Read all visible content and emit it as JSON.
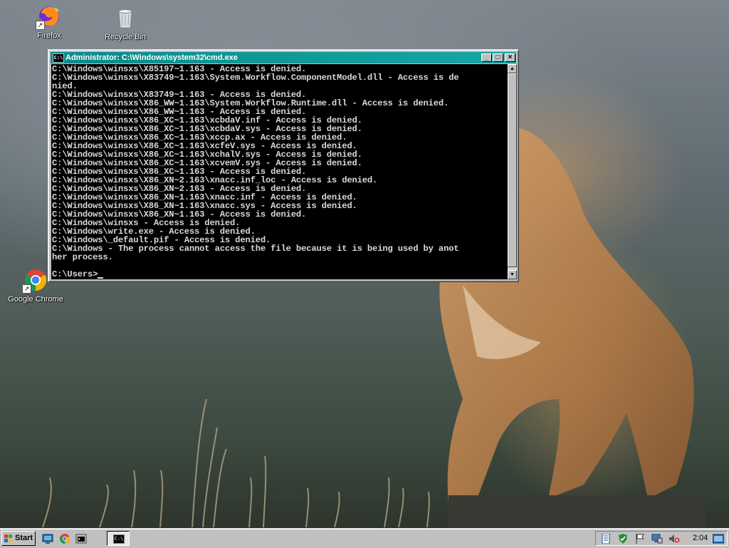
{
  "desktop": {
    "icons": [
      {
        "label": "Firefox",
        "icon": "firefox-icon"
      },
      {
        "label": "Recycle Bin",
        "icon": "recycle-bin-icon"
      },
      {
        "label": "Google Chrome",
        "icon": "chrome-icon"
      }
    ]
  },
  "cmd": {
    "title": "Administrator: C:\\Windows\\system32\\cmd.exe",
    "icon_label": "C:\\",
    "lines": [
      "C:\\Windows\\winsxs\\X85197~1.163 - Access is denied.",
      "C:\\Windows\\winsxs\\X83749~1.163\\System.Workflow.ComponentModel.dll - Access is de",
      "nied.",
      "C:\\Windows\\winsxs\\X83749~1.163 - Access is denied.",
      "C:\\Windows\\winsxs\\X86_WW~1.163\\System.Workflow.Runtime.dll - Access is denied.",
      "C:\\Windows\\winsxs\\X86_WW~1.163 - Access is denied.",
      "C:\\Windows\\winsxs\\X86_XC~1.163\\xcbdaV.inf - Access is denied.",
      "C:\\Windows\\winsxs\\X86_XC~1.163\\xcbdaV.sys - Access is denied.",
      "C:\\Windows\\winsxs\\X86_XC~1.163\\xccp.ax - Access is denied.",
      "C:\\Windows\\winsxs\\X86_XC~1.163\\xcfeV.sys - Access is denied.",
      "C:\\Windows\\winsxs\\X86_XC~1.163\\xchalV.sys - Access is denied.",
      "C:\\Windows\\winsxs\\X86_XC~1.163\\xcvemV.sys - Access is denied.",
      "C:\\Windows\\winsxs\\X86_XC~1.163 - Access is denied.",
      "C:\\Windows\\winsxs\\X86_XN~2.163\\xnacc.inf_loc - Access is denied.",
      "C:\\Windows\\winsxs\\X86_XN~2.163 - Access is denied.",
      "C:\\Windows\\winsxs\\X86_XN~1.163\\xnacc.inf - Access is denied.",
      "C:\\Windows\\winsxs\\X86_XN~1.163\\xnacc.sys - Access is denied.",
      "C:\\Windows\\winsxs\\X86_XN~1.163 - Access is denied.",
      "C:\\Windows\\winsxs - Access is denied.",
      "C:\\Windows\\write.exe - Access is denied.",
      "C:\\Windows\\_default.pif - Access is denied.",
      "C:\\Windows - The process cannot access the file because it is being used by anot",
      "her process.",
      ""
    ],
    "prompt": "C:\\Users>"
  },
  "taskbar": {
    "start_label": "Start",
    "quick_launch": [
      "show-desktop-icon",
      "chrome-icon",
      "cmd-icon"
    ],
    "task_icon_label": "C:\\",
    "tray_icons": [
      "notes-icon",
      "shield-check-icon",
      "flag-icon",
      "network-icon",
      "volume-muted-icon"
    ],
    "clock": "2:04"
  },
  "colors": {
    "titlebar": "#0a8a8a",
    "console_bg": "#000000",
    "console_fg": "#d8d8d8",
    "chrome": "#c0c0c0"
  }
}
